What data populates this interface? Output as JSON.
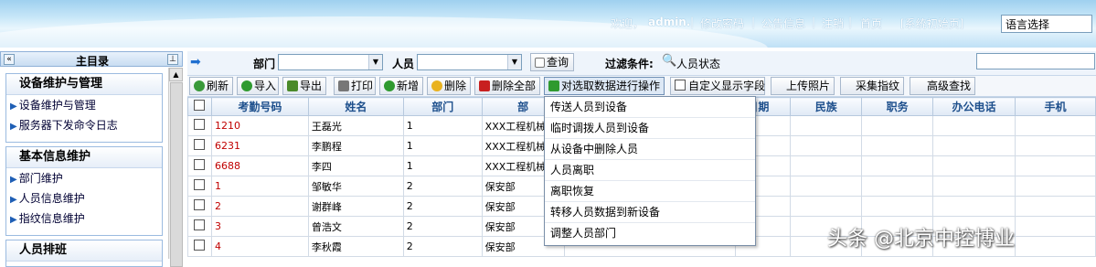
{
  "header": {
    "links": [
      "欢迎，",
      "admin.",
      "|",
      "修改密码",
      "|",
      "公告信息",
      "|",
      "注销",
      "|",
      "首页",
      "[系统初始页]"
    ],
    "language_select": "语言选择"
  },
  "sidebar": {
    "title": "主目录",
    "collapse_glyph": "«",
    "pin_glyph": "⊥",
    "groups": [
      {
        "title": "设备维护与管理",
        "items": [
          "设备维护与管理",
          "服务器下发命令日志"
        ]
      },
      {
        "title": "基本信息维护",
        "items": [
          "部门维护",
          "人员信息维护",
          "指纹信息维护"
        ]
      },
      {
        "title": "人员排班",
        "items": []
      }
    ]
  },
  "filter": {
    "dept_label": "部门",
    "person_label": "人员",
    "query_button": "查询",
    "filter_label": "过滤条件:",
    "status_label": "人员状态"
  },
  "toolbar": {
    "refresh": "刷新",
    "import": "导入",
    "export": "导出",
    "print": "打印",
    "add": "新增",
    "delete": "删除",
    "delete_all": "删除全部",
    "operate_selected": "对选取数据进行操作",
    "custom_fields": "自定义显示字段",
    "upload_photo": "上传照片",
    "collect_fp": "采集指纹",
    "advanced_search": "高级查找"
  },
  "table": {
    "headers": [
      "考勤号码",
      "姓名",
      "部门",
      "部",
      "",
      "生日期",
      "民族",
      "职务",
      "办公电话",
      "手机"
    ],
    "rows": [
      [
        "1210",
        "王磊光",
        "1",
        "XXX工程机械"
      ],
      [
        "6231",
        "李鹏程",
        "1",
        "XXX工程机械"
      ],
      [
        "6688",
        "李四",
        "1",
        "XXX工程机械"
      ],
      [
        "1",
        "邹敏华",
        "2",
        "保安部"
      ],
      [
        "2",
        "谢群峰",
        "2",
        "保安部"
      ],
      [
        "3",
        "曾浩文",
        "2",
        "保安部"
      ],
      [
        "4",
        "李秋霞",
        "2",
        "保安部"
      ]
    ]
  },
  "menu": {
    "items": [
      "传送人员到设备",
      "临时调拨人员到设备",
      "从设备中删除人员",
      "人员离职",
      "离职恢复",
      "转移人员数据到新设备",
      "调整人员部门"
    ]
  },
  "watermark": "头条 @北京中控博业",
  "colors": {
    "header_blue": "#9fd0ef",
    "link_red": "#c00000",
    "header_text": "#1d4f8c"
  }
}
